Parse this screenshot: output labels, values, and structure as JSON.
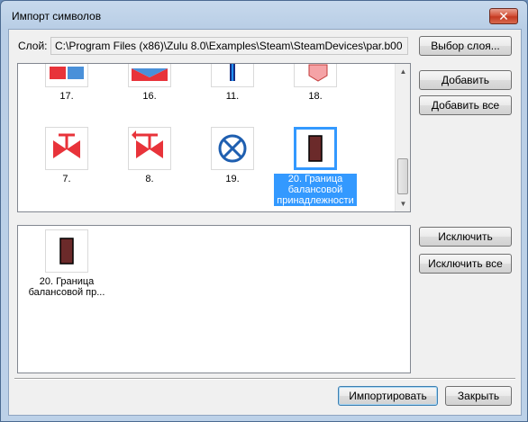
{
  "window": {
    "title": "Импорт символов",
    "close_label": "✕"
  },
  "layer": {
    "label": "Слой:",
    "path": "C:\\Program Files (x86)\\Zulu 8.0\\Examples\\Steam\\SteamDevices\\par.b00",
    "choose_button": "Выбор слоя..."
  },
  "source_list": {
    "row1": [
      "17.",
      "16.",
      "11.",
      "18."
    ],
    "row2": [
      "7.",
      "8.",
      "19.",
      "20. Граница балансовой принадлежности"
    ],
    "selected": "20. Граница балансовой принадлежности"
  },
  "actions": {
    "add": "Добавить",
    "add_all": "Добавить все",
    "exclude": "Исключить",
    "exclude_all": "Исключить все"
  },
  "target_list": {
    "items": [
      "20. Граница балансовой пр..."
    ]
  },
  "footer": {
    "import": "Импортировать",
    "close": "Закрыть"
  },
  "colors": {
    "accent": "#3399ff",
    "symbol_red": "#e8333a",
    "symbol_blue": "#1f5fb0",
    "boundary_brown": "#6b2a2a"
  }
}
